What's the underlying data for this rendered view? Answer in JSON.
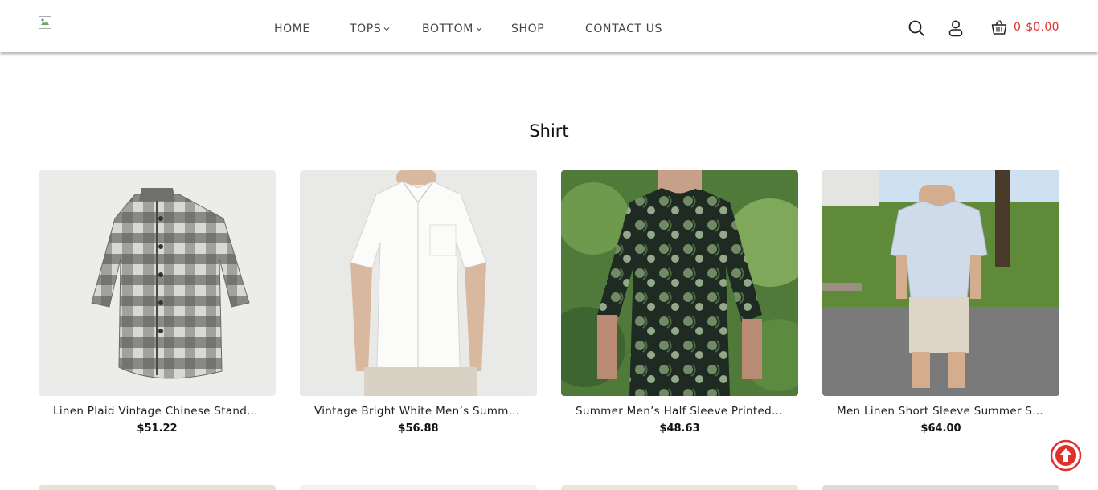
{
  "header": {
    "nav": [
      {
        "label": "HOME",
        "dropdown": false
      },
      {
        "label": "TOPS",
        "dropdown": true
      },
      {
        "label": "BOTTOM",
        "dropdown": true
      },
      {
        "label": "SHOP",
        "dropdown": false
      },
      {
        "label": "CONTACT US",
        "dropdown": false
      }
    ],
    "cart": {
      "count": "0",
      "total": "$0.00",
      "color": "#e0302a"
    },
    "icons": [
      "search-icon",
      "user-icon",
      "basket-icon"
    ]
  },
  "section": {
    "title": "Shirt"
  },
  "products": [
    {
      "name": "Linen Plaid Vintage Chinese Stand Collar Shirt",
      "price": "$51.22"
    },
    {
      "name": "Vintage Bright White Men’s Summer Shirt",
      "price": "$56.88"
    },
    {
      "name": "Summer Men’s Half Sleeve Printed Shirt",
      "price": "$48.63"
    },
    {
      "name": "Men Linen Short Sleeve Summer Stand Collar Shirt",
      "price": "$64.00"
    }
  ],
  "accent_color": "#e0302a"
}
